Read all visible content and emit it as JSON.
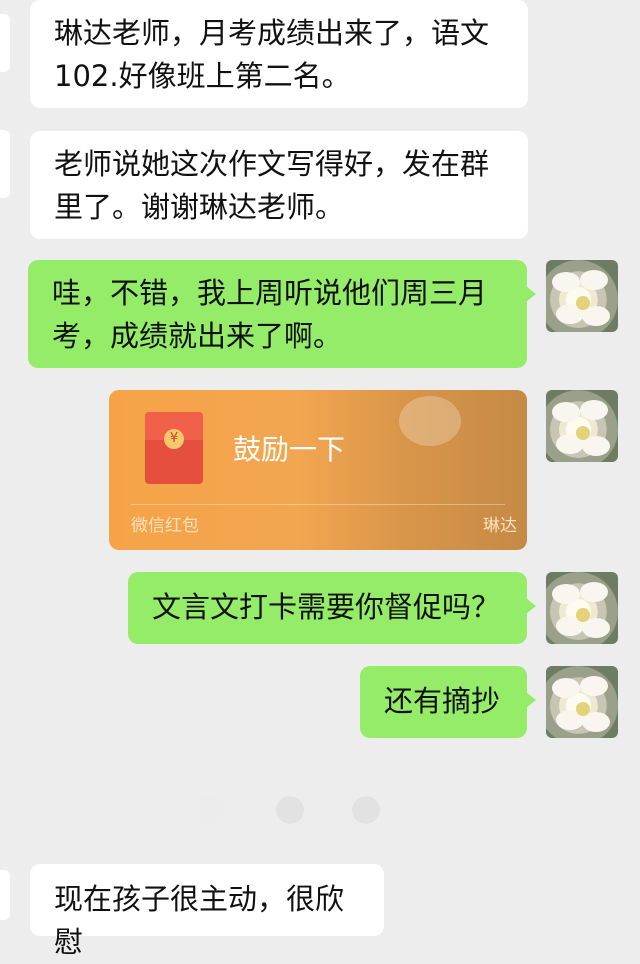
{
  "messages": [
    {
      "side": "left",
      "text": "琳达老师，月考成绩出来了，语文102.好像班上第二名。"
    },
    {
      "side": "left",
      "text": "老师说她这次作文写得好，发在群里了。谢谢琳达老师。"
    },
    {
      "side": "right",
      "text": "哇，不错，我上周听说他们周三月考，成绩就出来了啊。"
    },
    {
      "side": "right",
      "type": "red_packet",
      "title": "鼓励一下",
      "source": "微信红包",
      "sender": "琳达",
      "coin_symbol": "¥"
    },
    {
      "side": "right",
      "text": "文言文打卡需要你督促吗？"
    },
    {
      "side": "right",
      "text": "还有摘抄"
    },
    {
      "side": "left",
      "text": "现在孩子很主动，很欣慰"
    }
  ],
  "colors": {
    "background": "#ededed",
    "incoming_bubble": "#ffffff",
    "outgoing_bubble": "#95ec69",
    "red_packet": "#f6a348"
  },
  "icons": [
    "user-avatar-flower",
    "red-envelope-icon"
  ]
}
